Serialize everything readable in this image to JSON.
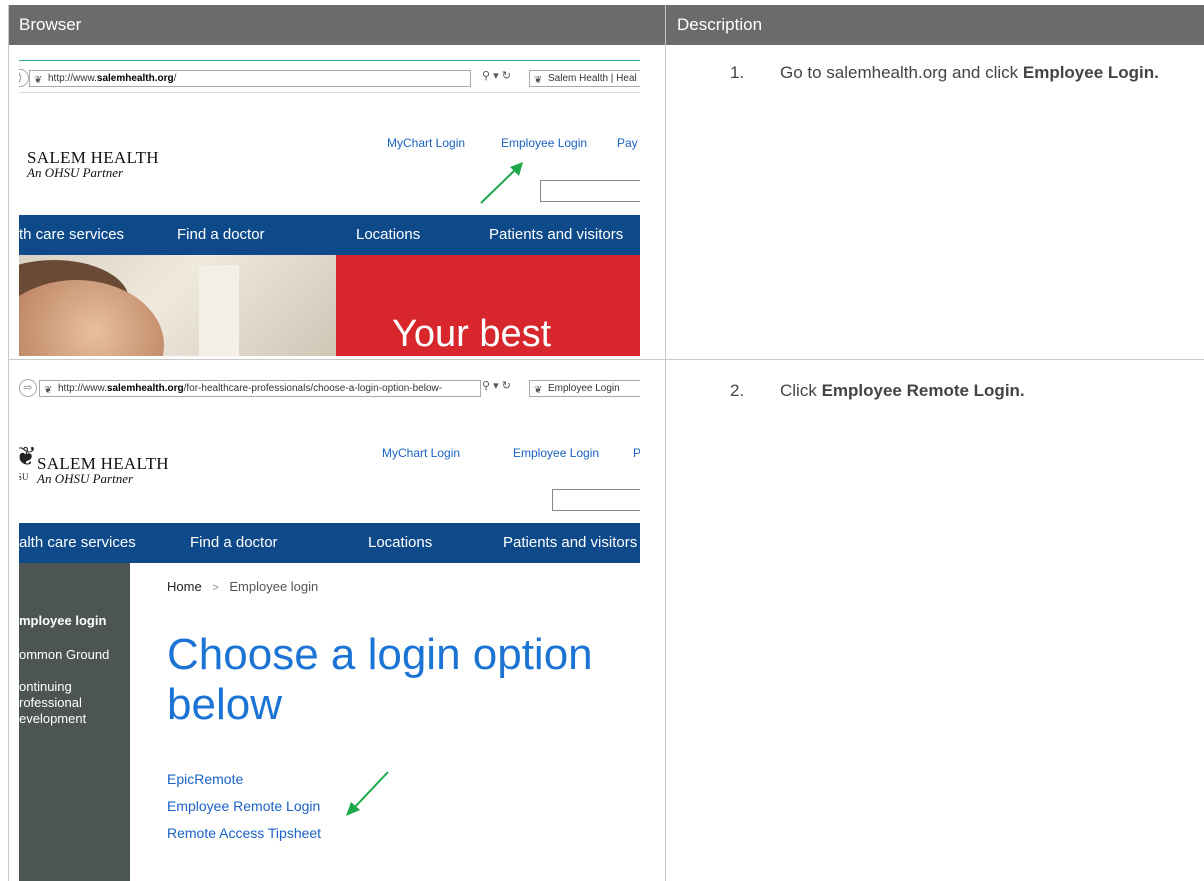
{
  "table": {
    "col_browser": "Browser",
    "col_description": "Description"
  },
  "steps": [
    {
      "number": "1.",
      "text_prefix": "Go to salemhealth.org and click ",
      "text_bold": "Employee Login."
    },
    {
      "number": "2.",
      "text_prefix": "Click ",
      "text_bold": "Employee Remote Login."
    }
  ],
  "shot1": {
    "url_prefix": "http://www.",
    "url_domain": "salemhealth.org",
    "url_suffix": "/",
    "tab_title": "Salem Health | Heal",
    "logo_name": "SALEM HEALTH",
    "logo_tagline": "An OHSU Partner",
    "links": [
      "MyChart Login",
      "Employee Login",
      "Pay"
    ],
    "nav": [
      "th care services",
      "Find a doctor",
      "Locations",
      "Patients and visitors"
    ],
    "hero_text": "Your best"
  },
  "shot2": {
    "url_prefix": "http://www.",
    "url_domain": "salemhealth.org",
    "url_suffix": "/for-healthcare-professionals/choose-a-login-option-below-",
    "tab_title": "Employee Login",
    "logo_name": "SALEM HEALTH",
    "logo_tagline": "An OHSU Partner",
    "logo_fragment": "SU",
    "links": [
      "MyChart Login",
      "Employee Login",
      "P"
    ],
    "nav": [
      "alth care services",
      "Find a doctor",
      "Locations",
      "Patients and visitors"
    ],
    "breadcrumb_home": "Home",
    "breadcrumb_sep": ">",
    "breadcrumb_current": "Employee login",
    "sidebar": [
      "mployee login",
      "ommon Ground",
      "ontinuing",
      "rofessional",
      "evelopment"
    ],
    "heading_line1": "Choose a login option",
    "heading_line2": "below",
    "login_options": [
      "EpicRemote",
      "Employee Remote Login",
      "Remote Access Tipsheet"
    ]
  },
  "colors": {
    "header_bg": "#6b6b6b",
    "nav_blue": "#0e4a8a",
    "link_blue": "#1a62c4",
    "arrow_green": "#1aa84a",
    "hero_red": "#d7262c"
  }
}
